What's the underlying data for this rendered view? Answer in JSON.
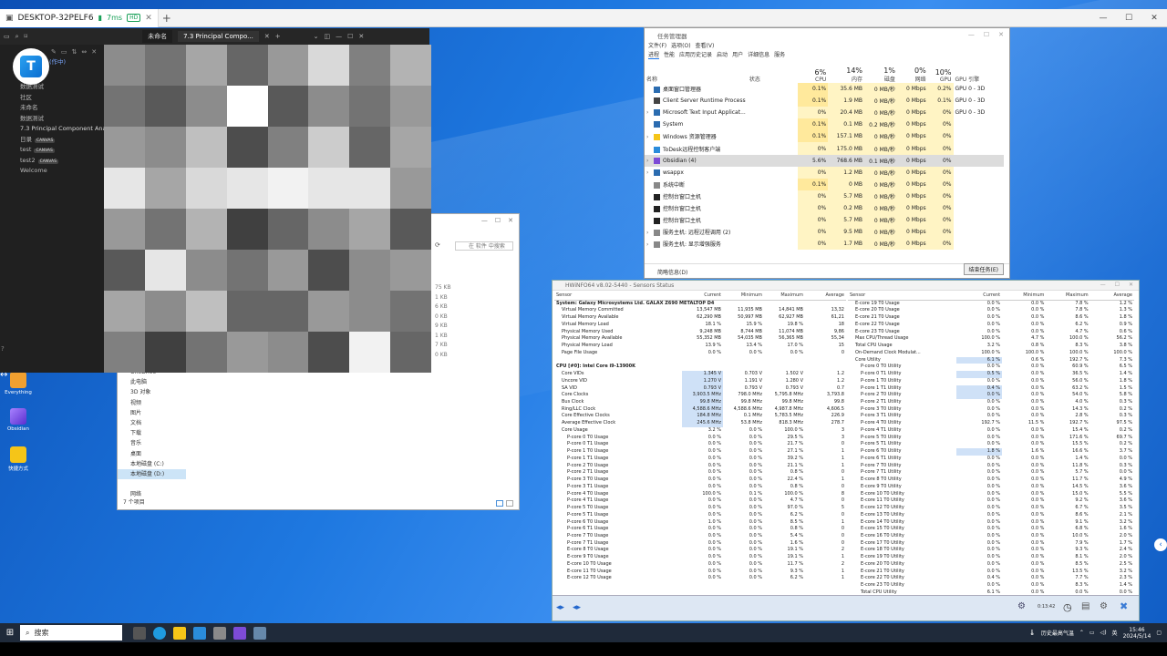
{
  "remote": {
    "host": "DESKTOP-32PELF6",
    "latency": "7ms",
    "quality": "HD",
    "new_tab": "+"
  },
  "obsidian": {
    "tabs": [
      {
        "label": "未命名"
      },
      {
        "label": "7.3 Principal Compo..."
      }
    ],
    "sidebar": [
      {
        "label": "(作中)"
      },
      {
        "label": "我的文件"
      },
      {
        "label": "数据测试"
      },
      {
        "label": "社区"
      },
      {
        "label": "未命名"
      },
      {
        "label": "数据测试"
      },
      {
        "label": "7.3 Principal Component Analysis"
      },
      {
        "label": "日录",
        "badge": "CANVAS"
      },
      {
        "label": "test",
        "badge": "CANVAS"
      },
      {
        "label": "test2",
        "badge": "CANVAS"
      },
      {
        "label": "Welcome"
      }
    ]
  },
  "explorer": {
    "search_placeholder": "在 软件 中搜索",
    "sizes": [
      "75 KB",
      "1 KB",
      "6 KB",
      "0 KB",
      "9 KB",
      "1 KB",
      "7 KB",
      "0 KB"
    ],
    "nav": [
      {
        "label": "OneDrive"
      },
      {
        "label": "此电脑"
      },
      {
        "label": "3D 对象"
      },
      {
        "label": "视频"
      },
      {
        "label": "图片"
      },
      {
        "label": "文档"
      },
      {
        "label": "下载"
      },
      {
        "label": "音乐"
      },
      {
        "label": "桌面"
      },
      {
        "label": "本地磁盘 (C:)"
      },
      {
        "label": "本地磁盘 (D:)",
        "selected": true
      },
      {
        "label": ""
      },
      {
        "label": "网络"
      }
    ],
    "count": "7 个项目"
  },
  "taskmgr": {
    "title": "任务管理器",
    "menu": [
      "文件(F)",
      "选项(O)",
      "查看(V)"
    ],
    "tabs": [
      "进程",
      "性能",
      "应用历史记录",
      "启动",
      "用户",
      "详细信息",
      "服务"
    ],
    "headers": {
      "name": "名称",
      "status": "状态",
      "cpu_pct": "6%",
      "cpu": "CPU",
      "mem_pct": "14%",
      "mem": "内存",
      "disk_pct": "1%",
      "disk": "磁盘",
      "net_pct": "0%",
      "net": "网络",
      "gpu_pct": "10%",
      "gpu": "GPU",
      "gpu_engine": "GPU 引擎"
    },
    "rows": [
      {
        "name": "桌面窗口管理器",
        "cpu": "0.1%",
        "mem": "35.6 MB",
        "disk": "0 MB/秒",
        "net": "0 Mbps",
        "gpu": "0.2%",
        "engine": "GPU 0 - 3D"
      },
      {
        "name": "Client Server Runtime Process",
        "cpu": "0.1%",
        "mem": "1.9 MB",
        "disk": "0 MB/秒",
        "net": "0 Mbps",
        "gpu": "0.1%",
        "engine": "GPU 0 - 3D"
      },
      {
        "name": "Microsoft Text Input Applicat...",
        "cpu": "0%",
        "mem": "20.4 MB",
        "disk": "0 MB/秒",
        "net": "0 Mbps",
        "gpu": "0%",
        "engine": "GPU 0 - 3D"
      },
      {
        "name": "System",
        "cpu": "0.1%",
        "mem": "0.1 MB",
        "disk": "0.2 MB/秒",
        "net": "0 Mbps",
        "gpu": "0%",
        "engine": ""
      },
      {
        "name": "Windows 资源管理器",
        "cpu": "0.1%",
        "mem": "157.1 MB",
        "disk": "0 MB/秒",
        "net": "0 Mbps",
        "gpu": "0%",
        "engine": ""
      },
      {
        "name": "ToDesk远程控制客户端",
        "cpu": "0%",
        "mem": "175.0 MB",
        "disk": "0 MB/秒",
        "net": "0 Mbps",
        "gpu": "0%",
        "engine": ""
      },
      {
        "name": "Obsidian (4)",
        "cpu": "5.6%",
        "mem": "768.6 MB",
        "disk": "0.1 MB/秒",
        "net": "0 Mbps",
        "gpu": "0%",
        "engine": "",
        "selected": true
      },
      {
        "name": "wsappx",
        "cpu": "0%",
        "mem": "1.2 MB",
        "disk": "0 MB/秒",
        "net": "0 Mbps",
        "gpu": "0%",
        "engine": ""
      },
      {
        "name": "系统中断",
        "cpu": "0.1%",
        "mem": "0 MB",
        "disk": "0 MB/秒",
        "net": "0 Mbps",
        "gpu": "0%",
        "engine": ""
      },
      {
        "name": "控制台窗口主机",
        "cpu": "0%",
        "mem": "5.7 MB",
        "disk": "0 MB/秒",
        "net": "0 Mbps",
        "gpu": "0%",
        "engine": ""
      },
      {
        "name": "控制台窗口主机",
        "cpu": "0%",
        "mem": "0.2 MB",
        "disk": "0 MB/秒",
        "net": "0 Mbps",
        "gpu": "0%",
        "engine": ""
      },
      {
        "name": "控制台窗口主机",
        "cpu": "0%",
        "mem": "5.7 MB",
        "disk": "0 MB/秒",
        "net": "0 Mbps",
        "gpu": "0%",
        "engine": ""
      },
      {
        "name": "服务主机: 远程过程调用 (2)",
        "cpu": "0%",
        "mem": "9.5 MB",
        "disk": "0 MB/秒",
        "net": "0 Mbps",
        "gpu": "0%",
        "engine": ""
      },
      {
        "name": "服务主机: 显示增强服务",
        "cpu": "0%",
        "mem": "1.7 MB",
        "disk": "0 MB/秒",
        "net": "0 Mbps",
        "gpu": "0%",
        "engine": ""
      }
    ],
    "fewer": "简略信息(D)",
    "end_task": "结束任务(E)"
  },
  "hwinfo": {
    "title": "HWiNFO64 v8.02-5440 - Sensors Status",
    "cols": [
      "Sensor",
      "Current",
      "Minimum",
      "Maximum",
      "Average"
    ],
    "left": [
      {
        "g": "System: Galaxy Microsystems Ltd. GALAX Z690 METALTOP D4"
      },
      {
        "n": "Virtual Memory Committed",
        "c": "13,547 MB",
        "mi": "11,935 MB",
        "ma": "14,841 MB",
        "a": "13,32"
      },
      {
        "n": "Virtual Memory Available",
        "c": "62,290 MB",
        "mi": "50,997 MB",
        "ma": "62,927 MB",
        "a": "61,21"
      },
      {
        "n": "Virtual Memory Load",
        "c": "18.1 %",
        "mi": "15.9 %",
        "ma": "19.8 %",
        "a": "18"
      },
      {
        "n": "Physical Memory Used",
        "c": "9,248 MB",
        "mi": "8,744 MB",
        "ma": "11,074 MB",
        "a": "9,86"
      },
      {
        "n": "Physical Memory Available",
        "c": "55,352 MB",
        "mi": "54,035 MB",
        "ma": "56,365 MB",
        "a": "55,34"
      },
      {
        "n": "Physical Memory Load",
        "c": "13.9 %",
        "mi": "13.4 %",
        "ma": "17.0 %",
        "a": "15"
      },
      {
        "n": "Page File Usage",
        "c": "0.0 %",
        "mi": "0.0 %",
        "ma": "0.0 %",
        "a": "0"
      },
      {
        "n": "",
        "c": "",
        "mi": "",
        "ma": "",
        "a": ""
      },
      {
        "g": "CPU [#0]: Intel Core i9-13900K"
      },
      {
        "n": "Core VIDs",
        "c": "1.345 V",
        "mi": "0.703 V",
        "ma": "1.502 V",
        "a": "1.2"
      },
      {
        "n": "Uncore VID",
        "c": "1.270 V",
        "mi": "1.191 V",
        "ma": "1.280 V",
        "a": "1.2"
      },
      {
        "n": "SA VID",
        "c": "0.793 V",
        "mi": "0.793 V",
        "ma": "0.793 V",
        "a": "0.7"
      },
      {
        "n": "Core Clocks",
        "c": "3,903.5 MHz",
        "mi": "798.0 MHz",
        "ma": "5,795.8 MHz",
        "a": "3,793.8"
      },
      {
        "n": "Bus Clock",
        "c": "99.8 MHz",
        "mi": "99.8 MHz",
        "ma": "99.8 MHz",
        "a": "99.8"
      },
      {
        "n": "Ring/LLC Clock",
        "c": "4,588.6 MHz",
        "mi": "4,588.6 MHz",
        "ma": "4,987.8 MHz",
        "a": "4,606.5"
      },
      {
        "n": "Core Effective Clocks",
        "c": "184.8 MHz",
        "mi": "0.1 MHz",
        "ma": "5,783.5 MHz",
        "a": "226.9"
      },
      {
        "n": "Average Effective Clock",
        "c": "245.6 MHz",
        "mi": "53.8 MHz",
        "ma": "818.3 MHz",
        "a": "278.7"
      },
      {
        "n": "Core Usage",
        "c": "3.2 %",
        "mi": "0.0 %",
        "ma": "100.0 %",
        "a": "3"
      },
      {
        "n": "P-core 0 T0 Usage",
        "c": "0.0 %",
        "mi": "0.0 %",
        "ma": "29.5 %",
        "a": "3"
      },
      {
        "n": "P-core 0 T1 Usage",
        "c": "0.0 %",
        "mi": "0.0 %",
        "ma": "21.7 %",
        "a": "0"
      },
      {
        "n": "P-core 1 T0 Usage",
        "c": "0.0 %",
        "mi": "0.0 %",
        "ma": "27.1 %",
        "a": "1"
      },
      {
        "n": "P-core 1 T1 Usage",
        "c": "0.0 %",
        "mi": "0.0 %",
        "ma": "39.2 %",
        "a": "1"
      },
      {
        "n": "P-core 2 T0 Usage",
        "c": "0.0 %",
        "mi": "0.0 %",
        "ma": "21.1 %",
        "a": "1"
      },
      {
        "n": "P-core 2 T1 Usage",
        "c": "0.0 %",
        "mi": "0.0 %",
        "ma": "0.8 %",
        "a": "0"
      },
      {
        "n": "P-core 3 T0 Usage",
        "c": "0.0 %",
        "mi": "0.0 %",
        "ma": "22.4 %",
        "a": "1"
      },
      {
        "n": "P-core 3 T1 Usage",
        "c": "0.0 %",
        "mi": "0.0 %",
        "ma": "0.8 %",
        "a": "0"
      },
      {
        "n": "P-core 4 T0 Usage",
        "c": "100.0 %",
        "mi": "0.1 %",
        "ma": "100.0 %",
        "a": "8"
      },
      {
        "n": "P-core 4 T1 Usage",
        "c": "0.0 %",
        "mi": "0.0 %",
        "ma": "4.7 %",
        "a": "0"
      },
      {
        "n": "P-core 5 T0 Usage",
        "c": "0.0 %",
        "mi": "0.0 %",
        "ma": "97.0 %",
        "a": "5"
      },
      {
        "n": "P-core 5 T1 Usage",
        "c": "0.0 %",
        "mi": "0.0 %",
        "ma": "6.2 %",
        "a": "0"
      },
      {
        "n": "P-core 6 T0 Usage",
        "c": "1.0 %",
        "mi": "0.0 %",
        "ma": "8.5 %",
        "a": "1"
      },
      {
        "n": "P-core 6 T1 Usage",
        "c": "0.0 %",
        "mi": "0.0 %",
        "ma": "0.8 %",
        "a": "0"
      },
      {
        "n": "P-core 7 T0 Usage",
        "c": "0.0 %",
        "mi": "0.0 %",
        "ma": "5.4 %",
        "a": "0"
      },
      {
        "n": "P-core 7 T1 Usage",
        "c": "0.0 %",
        "mi": "0.0 %",
        "ma": "1.6 %",
        "a": "0"
      },
      {
        "n": "E-core 8 T0 Usage",
        "c": "0.0 %",
        "mi": "0.0 %",
        "ma": "19.1 %",
        "a": "2"
      },
      {
        "n": "E-core 9 T0 Usage",
        "c": "0.0 %",
        "mi": "0.0 %",
        "ma": "19.1 %",
        "a": "1"
      },
      {
        "n": "E-core 10 T0 Usage",
        "c": "0.0 %",
        "mi": "0.0 %",
        "ma": "11.7 %",
        "a": "2"
      },
      {
        "n": "E-core 11 T0 Usage",
        "c": "0.0 %",
        "mi": "0.0 %",
        "ma": "9.3 %",
        "a": "1"
      },
      {
        "n": "E-core 12 T0 Usage",
        "c": "0.0 %",
        "mi": "0.0 %",
        "ma": "6.2 %",
        "a": "1"
      }
    ],
    "right": [
      {
        "n": "E-core 19 T0 Usage",
        "c": "0.0 %",
        "mi": "0.0 %",
        "ma": "7.8 %",
        "a": "1.2 %"
      },
      {
        "n": "E-core 20 T0 Usage",
        "c": "0.0 %",
        "mi": "0.0 %",
        "ma": "7.8 %",
        "a": "1.3 %"
      },
      {
        "n": "E-core 21 T0 Usage",
        "c": "0.0 %",
        "mi": "0.0 %",
        "ma": "8.6 %",
        "a": "1.8 %"
      },
      {
        "n": "E-core 22 T0 Usage",
        "c": "0.0 %",
        "mi": "0.0 %",
        "ma": "6.2 %",
        "a": "0.9 %"
      },
      {
        "n": "E-core 23 T0 Usage",
        "c": "0.0 %",
        "mi": "0.0 %",
        "ma": "4.7 %",
        "a": "0.6 %"
      },
      {
        "n": "Max CPU/Thread Usage",
        "c": "100.0 %",
        "mi": "4.7 %",
        "ma": "100.0 %",
        "a": "56.2 %"
      },
      {
        "n": "Total CPU Usage",
        "c": "3.2 %",
        "mi": "0.8 %",
        "ma": "8.3 %",
        "a": "3.8 %"
      },
      {
        "n": "On-Demand Clock Modulat...",
        "c": "100.0 %",
        "mi": "100.0 %",
        "ma": "100.0 %",
        "a": "100.0 %"
      },
      {
        "n": "Core Utility",
        "c": "6.1 %",
        "mi": "0.6 %",
        "ma": "192.7 %",
        "a": "7.3 %"
      },
      {
        "n": "P-core 0 T0 Utility",
        "c": "0.0 %",
        "mi": "0.0 %",
        "ma": "60.9 %",
        "a": "6.5 %"
      },
      {
        "n": "P-core 0 T1 Utility",
        "c": "0.5 %",
        "mi": "0.0 %",
        "ma": "36.5 %",
        "a": "1.4 %"
      },
      {
        "n": "P-core 1 T0 Utility",
        "c": "0.0 %",
        "mi": "0.0 %",
        "ma": "56.0 %",
        "a": "1.8 %"
      },
      {
        "n": "P-core 1 T1 Utility",
        "c": "0.4 %",
        "mi": "0.0 %",
        "ma": "63.2 %",
        "a": "1.5 %"
      },
      {
        "n": "P-core 2 T0 Utility",
        "c": "0.0 %",
        "mi": "0.0 %",
        "ma": "54.0 %",
        "a": "5.8 %"
      },
      {
        "n": "P-core 2 T1 Utility",
        "c": "0.0 %",
        "mi": "0.0 %",
        "ma": "4.0 %",
        "a": "0.3 %"
      },
      {
        "n": "P-core 3 T0 Utility",
        "c": "0.0 %",
        "mi": "0.0 %",
        "ma": "14.3 %",
        "a": "0.2 %"
      },
      {
        "n": "P-core 3 T1 Utility",
        "c": "0.0 %",
        "mi": "0.0 %",
        "ma": "2.8 %",
        "a": "0.3 %"
      },
      {
        "n": "P-core 4 T0 Utility",
        "c": "192.7 %",
        "mi": "11.5 %",
        "ma": "192.7 %",
        "a": "97.5 %"
      },
      {
        "n": "P-core 4 T1 Utility",
        "c": "0.0 %",
        "mi": "0.0 %",
        "ma": "15.4 %",
        "a": "0.2 %"
      },
      {
        "n": "P-core 5 T0 Utility",
        "c": "0.0 %",
        "mi": "0.0 %",
        "ma": "171.6 %",
        "a": "69.7 %"
      },
      {
        "n": "P-core 5 T1 Utility",
        "c": "0.0 %",
        "mi": "0.0 %",
        "ma": "15.5 %",
        "a": "0.2 %"
      },
      {
        "n": "P-core 6 T0 Utility",
        "c": "1.8 %",
        "mi": "1.6 %",
        "ma": "16.6 %",
        "a": "3.7 %"
      },
      {
        "n": "P-core 6 T1 Utility",
        "c": "0.0 %",
        "mi": "0.0 %",
        "ma": "1.4 %",
        "a": "0.0 %"
      },
      {
        "n": "P-core 7 T0 Utility",
        "c": "0.0 %",
        "mi": "0.0 %",
        "ma": "11.8 %",
        "a": "0.3 %"
      },
      {
        "n": "P-core 7 T1 Utility",
        "c": "0.0 %",
        "mi": "0.0 %",
        "ma": "5.7 %",
        "a": "0.0 %"
      },
      {
        "n": "E-core 8 T0 Utility",
        "c": "0.0 %",
        "mi": "0.0 %",
        "ma": "11.7 %",
        "a": "4.9 %"
      },
      {
        "n": "E-core 9 T0 Utility",
        "c": "0.0 %",
        "mi": "0.0 %",
        "ma": "14.5 %",
        "a": "3.6 %"
      },
      {
        "n": "E-core 10 T0 Utility",
        "c": "0.0 %",
        "mi": "0.0 %",
        "ma": "15.0 %",
        "a": "5.5 %"
      },
      {
        "n": "E-core 11 T0 Utility",
        "c": "0.0 %",
        "mi": "0.0 %",
        "ma": "9.2 %",
        "a": "3.6 %"
      },
      {
        "n": "E-core 12 T0 Utility",
        "c": "0.0 %",
        "mi": "0.0 %",
        "ma": "6.7 %",
        "a": "3.5 %"
      },
      {
        "n": "E-core 13 T0 Utility",
        "c": "0.0 %",
        "mi": "0.0 %",
        "ma": "8.6 %",
        "a": "2.1 %"
      },
      {
        "n": "E-core 14 T0 Utility",
        "c": "0.0 %",
        "mi": "0.0 %",
        "ma": "9.1 %",
        "a": "3.2 %"
      },
      {
        "n": "E-core 15 T0 Utility",
        "c": "0.0 %",
        "mi": "0.0 %",
        "ma": "6.8 %",
        "a": "1.6 %"
      },
      {
        "n": "E-core 16 T0 Utility",
        "c": "0.0 %",
        "mi": "0.0 %",
        "ma": "10.0 %",
        "a": "2.0 %"
      },
      {
        "n": "E-core 17 T0 Utility",
        "c": "0.0 %",
        "mi": "0.0 %",
        "ma": "7.9 %",
        "a": "1.7 %"
      },
      {
        "n": "E-core 18 T0 Utility",
        "c": "0.0 %",
        "mi": "0.0 %",
        "ma": "9.3 %",
        "a": "2.4 %"
      },
      {
        "n": "E-core 19 T0 Utility",
        "c": "0.0 %",
        "mi": "0.0 %",
        "ma": "8.1 %",
        "a": "2.0 %"
      },
      {
        "n": "E-core 20 T0 Utility",
        "c": "0.0 %",
        "mi": "0.0 %",
        "ma": "8.5 %",
        "a": "2.5 %"
      },
      {
        "n": "E-core 21 T0 Utility",
        "c": "0.0 %",
        "mi": "0.0 %",
        "ma": "13.5 %",
        "a": "3.2 %"
      },
      {
        "n": "E-core 22 T0 Utility",
        "c": "0.4 %",
        "mi": "0.0 %",
        "ma": "7.7 %",
        "a": "2.3 %"
      },
      {
        "n": "E-core 23 T0 Utility",
        "c": "0.0 %",
        "mi": "0.0 %",
        "ma": "8.3 %",
        "a": "1.4 %"
      },
      {
        "n": "Total CPU Utility",
        "c": "6.1 %",
        "mi": "0.0 %",
        "ma": "0.0 %",
        "a": "0.0 %"
      }
    ],
    "timer": "0:13:42"
  },
  "desktop": {
    "icons": [
      {
        "label": "Everything"
      },
      {
        "label": "Obsidian"
      },
      {
        "label": "快捷方式"
      }
    ]
  },
  "taskbar": {
    "search": "搜索",
    "tray_text": "历史最高气温",
    "ime": "英",
    "time": "15:46",
    "date": "2024/5/14"
  },
  "obsidian_pixels": [
    [
      0.55,
      0.45,
      0.65,
      0.4,
      0.6,
      0.85,
      0.5,
      0.7
    ],
    [
      0.45,
      0.35,
      0.55,
      1.0,
      0.35,
      0.55,
      0.45,
      0.6
    ],
    [
      0.6,
      0.55,
      0.75,
      0.3,
      0.5,
      0.8,
      0.4,
      0.65
    ],
    [
      0.9,
      0.65,
      0.85,
      0.9,
      0.95,
      0.9,
      0.9,
      0.6
    ],
    [
      0.6,
      0.45,
      0.7,
      0.25,
      0.4,
      0.55,
      0.65,
      0.35
    ],
    [
      0.35,
      0.9,
      0.55,
      0.45,
      0.6,
      0.3,
      0.55,
      0.6
    ],
    [
      0.65,
      0.55,
      0.75,
      0.4,
      0.4,
      0.6,
      0.55,
      0.45
    ],
    [
      0.5,
      0.25,
      0.45,
      0.6,
      0.55,
      0.3,
      0.95,
      0.4
    ]
  ]
}
